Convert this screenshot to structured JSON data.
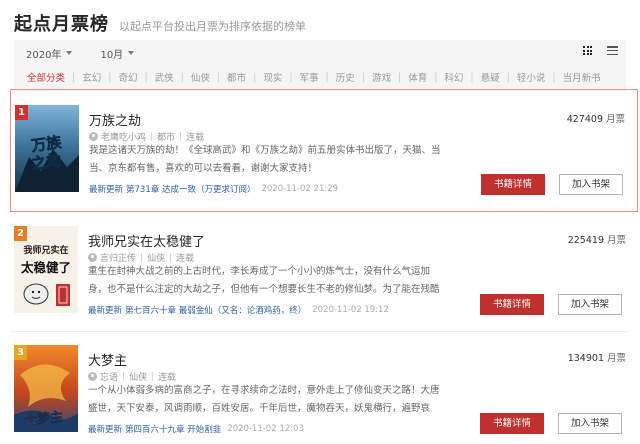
{
  "header": {
    "title": "起点月票榜",
    "subtitle": "以起点平台投出月票为排序依据的榜单"
  },
  "filters": {
    "year": "2020年",
    "month": "10月",
    "view_grid_icon": "grid-view-icon",
    "view_list_icon": "list-view-icon",
    "categories": [
      "全部分类",
      "玄幻",
      "奇幻",
      "武侠",
      "仙侠",
      "都市",
      "现实",
      "军事",
      "历史",
      "游戏",
      "体育",
      "科幻",
      "悬疑",
      "轻小说",
      "当月新书"
    ]
  },
  "buttons": {
    "detail": "书籍详情",
    "shelf": "加入书架"
  },
  "labels": {
    "latest_update": "最新更新",
    "vote_unit": "月票"
  },
  "colors": {
    "accent": "#c0302e",
    "link": "#2c62a6"
  },
  "books": [
    {
      "rank": "1",
      "name": "万族之劫",
      "author": "老鹰吃小鸡",
      "category": "都市",
      "status": "连载",
      "desc": "我是这诸天万族的劫！《全球高武》和《万族之劫》前五册实体书出版了，天猫、当当、京东都有售，喜欢的可以去看看，谢谢大家支持！",
      "latest_chapter": "第731章 达成一致（万更求订阅）",
      "time": "2020-11-02 21:29",
      "votes": "427409",
      "cover_text": "万族之劫"
    },
    {
      "rank": "2",
      "name": "我师兄实在太稳健了",
      "author": "言归正传",
      "category": "仙侠",
      "status": "连载",
      "desc": "重生在封神大战之前的上古时代，李长寿成了一个小小的炼气士，没有什么气运加身，也不是什么注定的大劫之子，但他有一个想要长生不老的修仙梦。为了能在残酷",
      "latest_chapter": "第七百六十章 最弱金仙（又名：论酒鸡药，终）",
      "time": "2020-11-02 19:12",
      "votes": "225419",
      "cover_text_top": "我师兄实在",
      "cover_text_main": "太稳健了"
    },
    {
      "rank": "3",
      "name": "大梦主",
      "author": "忘语",
      "category": "仙侠",
      "status": "连载",
      "desc": "一个从小体弱多病的富商之子，在寻求续命之法时，意外走上了修仙变天之路！大唐盛世，天下安泰，风调雨顺，百姓安居。千年后世，魔物吞天，妖鬼横行，遍野哀",
      "latest_chapter": "第四百六十九章 开始割韭",
      "time": "2020-11-02 12:03",
      "votes": "134901",
      "cover_text": "大梦主"
    }
  ]
}
